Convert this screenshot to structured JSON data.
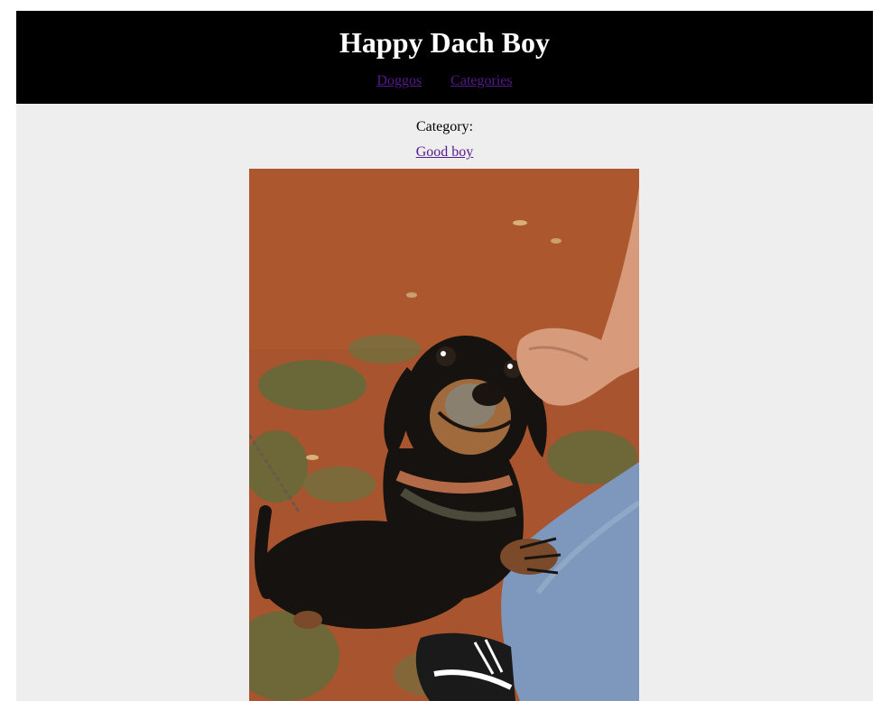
{
  "header": {
    "title": "Happy Dach Boy",
    "nav": [
      {
        "label": "Doggos"
      },
      {
        "label": "Categories"
      }
    ]
  },
  "main": {
    "category_label": "Category:",
    "category_link": "Good boy",
    "photo": {
      "subject": "dachshund-photo",
      "colors": {
        "dirt": "#a8542e",
        "grass": "#5f6b3a",
        "dog": "#151210",
        "tan": "#a06a3c",
        "collar": "#b56a47",
        "harness": "#4b4a3a",
        "jeans": "#7d98bc",
        "skin": "#d79a7b",
        "shoe": "#1a1a1a"
      }
    }
  },
  "colors": {
    "header_bg": "#000000",
    "page_bg": "#eeeeee",
    "title_text": "#ffffff",
    "link": "#551a8b"
  }
}
